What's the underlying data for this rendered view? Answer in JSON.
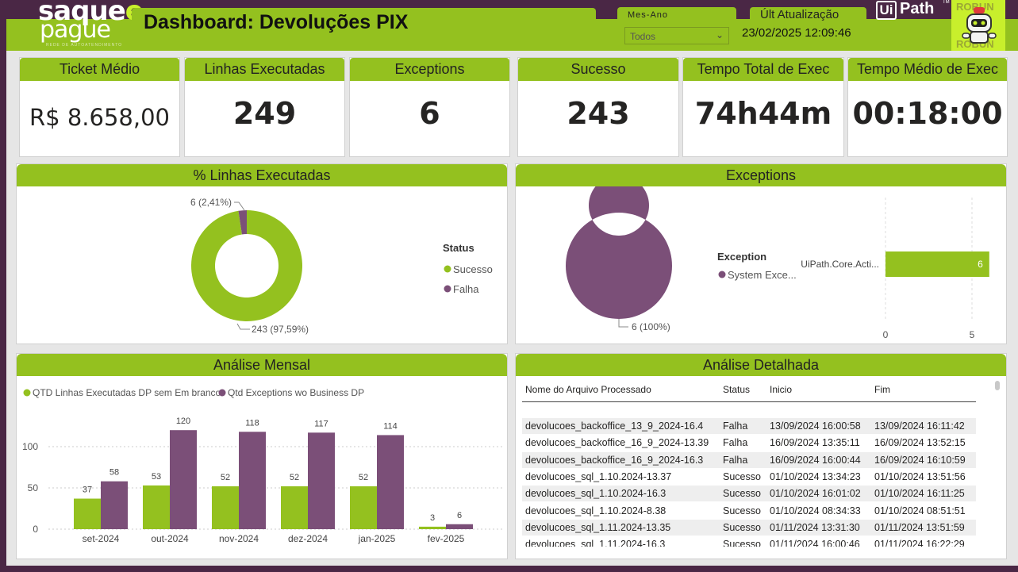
{
  "header": {
    "logo_line1": "saque",
    "logo_e": "e",
    "logo_line2": "pague",
    "logo_line3": "REDE DE AUTOATENDIMENTO",
    "title": "Dashboard: Devoluções PIX",
    "mesano_label": "Mes-Ano",
    "mesano_value": "Todos",
    "ult_label": "Últ Atualização",
    "ult_value": "23/02/2025 12:09:46",
    "uipath_box": "Ui",
    "uipath_rest": "Path",
    "uipath_tm": "TM",
    "robot_label": "ROBUN"
  },
  "kpis": [
    {
      "label": "Ticket Médio",
      "value": "R$ 8.658,00"
    },
    {
      "label": "Linhas Executadas",
      "value": "249"
    },
    {
      "label": "Exceptions",
      "value": "6"
    },
    {
      "label": "Sucesso",
      "value": "243"
    },
    {
      "label": "Tempo Total de Exec",
      "value": "74h44m"
    },
    {
      "label": "Tempo Médio de Exec",
      "value": "00:18:00"
    }
  ],
  "colors": {
    "green": "#94c11f",
    "purple": "#7b4f78",
    "bg": "#4a2745"
  },
  "chart_data": [
    {
      "type": "pie",
      "title": "% Linhas Executadas",
      "legend_title": "Status",
      "legend": [
        "Sucesso",
        "Falha"
      ],
      "slices": [
        {
          "name": "Sucesso",
          "value": 243,
          "label": "243 (97,59%)"
        },
        {
          "name": "Falha",
          "value": 6,
          "label": "6 (2,41%)"
        }
      ]
    },
    {
      "type": "pie",
      "title": "Exceptions",
      "legend_title": "Exception",
      "legend": [
        "System Exce..."
      ],
      "slices": [
        {
          "name": "System Exce...",
          "value": 6,
          "label": "6 (100%)"
        }
      ]
    },
    {
      "type": "bar",
      "orientation": "horizontal",
      "categories": [
        "UiPath.Core.Acti..."
      ],
      "values": [
        6
      ],
      "xlim": [
        0,
        6.5
      ],
      "xticks": [
        "0",
        "5"
      ],
      "data_labels": [
        "6"
      ]
    },
    {
      "type": "bar",
      "title": "Análise Mensal",
      "categories": [
        "set-2024",
        "out-2024",
        "nov-2024",
        "dez-2024",
        "jan-2025",
        "fev-2025"
      ],
      "series": [
        {
          "name": "QTD Linhas Executadas DP sem Em branco",
          "values": [
            37,
            53,
            52,
            52,
            52,
            3
          ]
        },
        {
          "name": "Qtd Exceptions wo Business DP",
          "values": [
            58,
            120,
            118,
            117,
            114,
            6
          ]
        }
      ],
      "ylim": [
        0,
        135
      ],
      "yticks": [
        "0",
        "50",
        "100"
      ],
      "grid": true,
      "legend_position": "top-left"
    }
  ],
  "table": {
    "title": "Análise Detalhada",
    "headers": [
      "Nome do Arquivo Processado",
      "Status",
      "Inicio",
      "Fim"
    ],
    "rows": [
      [
        "devolucoes_backoffice_13_9_2024-16.4",
        "Falha",
        "13/09/2024 16:00:58",
        "13/09/2024 16:11:42"
      ],
      [
        "devolucoes_backoffice_16_9_2024-13.39",
        "Falha",
        "16/09/2024 13:35:11",
        "16/09/2024 13:52:15"
      ],
      [
        "devolucoes_backoffice_16_9_2024-16.3",
        "Falha",
        "16/09/2024 16:00:44",
        "16/09/2024 16:10:59"
      ],
      [
        "devolucoes_sql_1.10.2024-13.37",
        "Sucesso",
        "01/10/2024 13:34:23",
        "01/10/2024 13:51:56"
      ],
      [
        "devolucoes_sql_1.10.2024-16.3",
        "Sucesso",
        "01/10/2024 16:01:02",
        "01/10/2024 16:11:25"
      ],
      [
        "devolucoes_sql_1.10.2024-8.38",
        "Sucesso",
        "01/10/2024 08:34:33",
        "01/10/2024 08:51:51"
      ],
      [
        "devolucoes_sql_1.11.2024-13.35",
        "Sucesso",
        "01/11/2024 13:31:30",
        "01/11/2024 13:51:59"
      ],
      [
        "devolucoes_sql_1.11.2024-16.3",
        "Sucesso",
        "01/11/2024 16:00:46",
        "01/11/2024 16:22:29"
      ]
    ]
  }
}
